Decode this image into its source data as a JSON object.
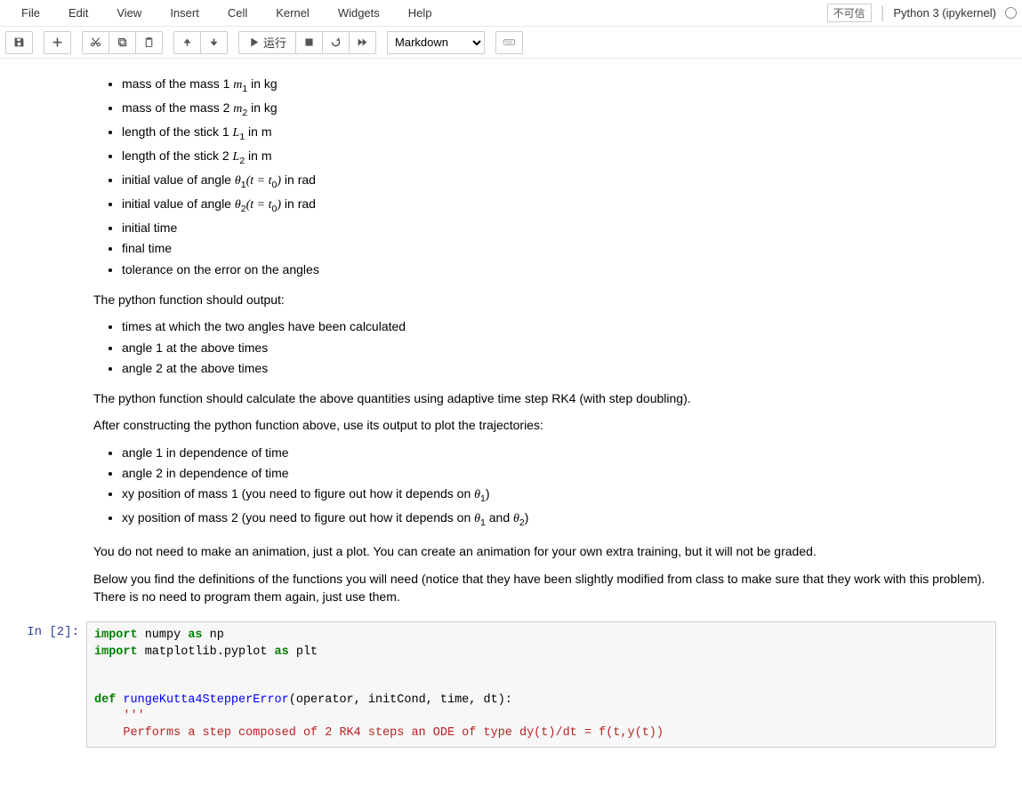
{
  "menubar": {
    "items": [
      "File",
      "Edit",
      "View",
      "Insert",
      "Cell",
      "Kernel",
      "Widgets",
      "Help"
    ],
    "not_trusted": "不可信",
    "kernel": "Python 3 (ipykernel)"
  },
  "toolbar": {
    "run_label": "运行",
    "celltype_selected": "Markdown"
  },
  "markdown": {
    "inputs": {
      "li1_a": "mass of the mass 1 ",
      "li1_m": "m",
      "li1_s": "1",
      "li1_b": " in kg",
      "li2_a": "mass of the mass 2 ",
      "li2_m": "m",
      "li2_s": "2",
      "li2_b": " in kg",
      "li3_a": "length of the stick 1 ",
      "li3_m": "L",
      "li3_s": "1",
      "li3_b": " in m",
      "li4_a": "length of the stick 2 ",
      "li4_m": "L",
      "li4_s": "2",
      "li4_b": " in m",
      "li5_a": "initial value of angle ",
      "li5_m": "θ",
      "li5_s": "1",
      "li5_p": "(t = t",
      "li5_p2": "0",
      "li5_p3": ")",
      "li5_b": " in rad",
      "li6_a": "initial value of angle ",
      "li6_m": "θ",
      "li6_s": "2",
      "li6_p": "(t = t",
      "li6_p2": "0",
      "li6_p3": ")",
      "li6_b": " in rad",
      "li7": "initial time",
      "li8": "final time",
      "li9": "tolerance on the error on the angles"
    },
    "p1": "The python function should output:",
    "outputs": {
      "o1": "times at which the two angles have been calculated",
      "o2": "angle 1 at the above times",
      "o3": "angle 2 at the above times"
    },
    "p2": "The python function should calculate the above quantities using adaptive time step RK4 (with step doubling).",
    "p3": "After constructing the python function above, use its output to plot the trajectories:",
    "traj": {
      "t1": "angle 1 in dependence of time",
      "t2": "angle 2 in dependence of time",
      "t3_a": "xy position of mass 1 (you need to figure out how it depends on ",
      "t3_m": "θ",
      "t3_s": "1",
      "t3_b": ")",
      "t4_a": "xy position of mass 2 (you need to figure out how it depends on ",
      "t4_m1": "θ",
      "t4_s1": "1",
      "t4_mid": " and ",
      "t4_m2": "θ",
      "t4_s2": "2",
      "t4_b": ")"
    },
    "p4": "You do not need to make an animation, just a plot. You can create an animation for your own extra training, but it will not be graded.",
    "p5": "Below you find the definitions of the functions you will need (notice that they have been slightly modified from class to make sure that they work with this problem). There is no need to program them again, just use them."
  },
  "code": {
    "prompt": "In [2]:",
    "l1_k1": "import",
    "l1_t1": " numpy ",
    "l1_k2": "as",
    "l1_t2": " np",
    "l2_k1": "import",
    "l2_t1": " matplotlib.pyplot ",
    "l2_k2": "as",
    "l2_t2": " plt",
    "l4_k1": "def",
    "l4_fn": " rungeKutta4StepperError",
    "l4_args": "(operator, initCond, time, dt):",
    "l5": "    '''",
    "l6": "    Performs a step composed of 2 RK4 steps an ODE of type dy(t)/dt = f(t,y(t))"
  }
}
